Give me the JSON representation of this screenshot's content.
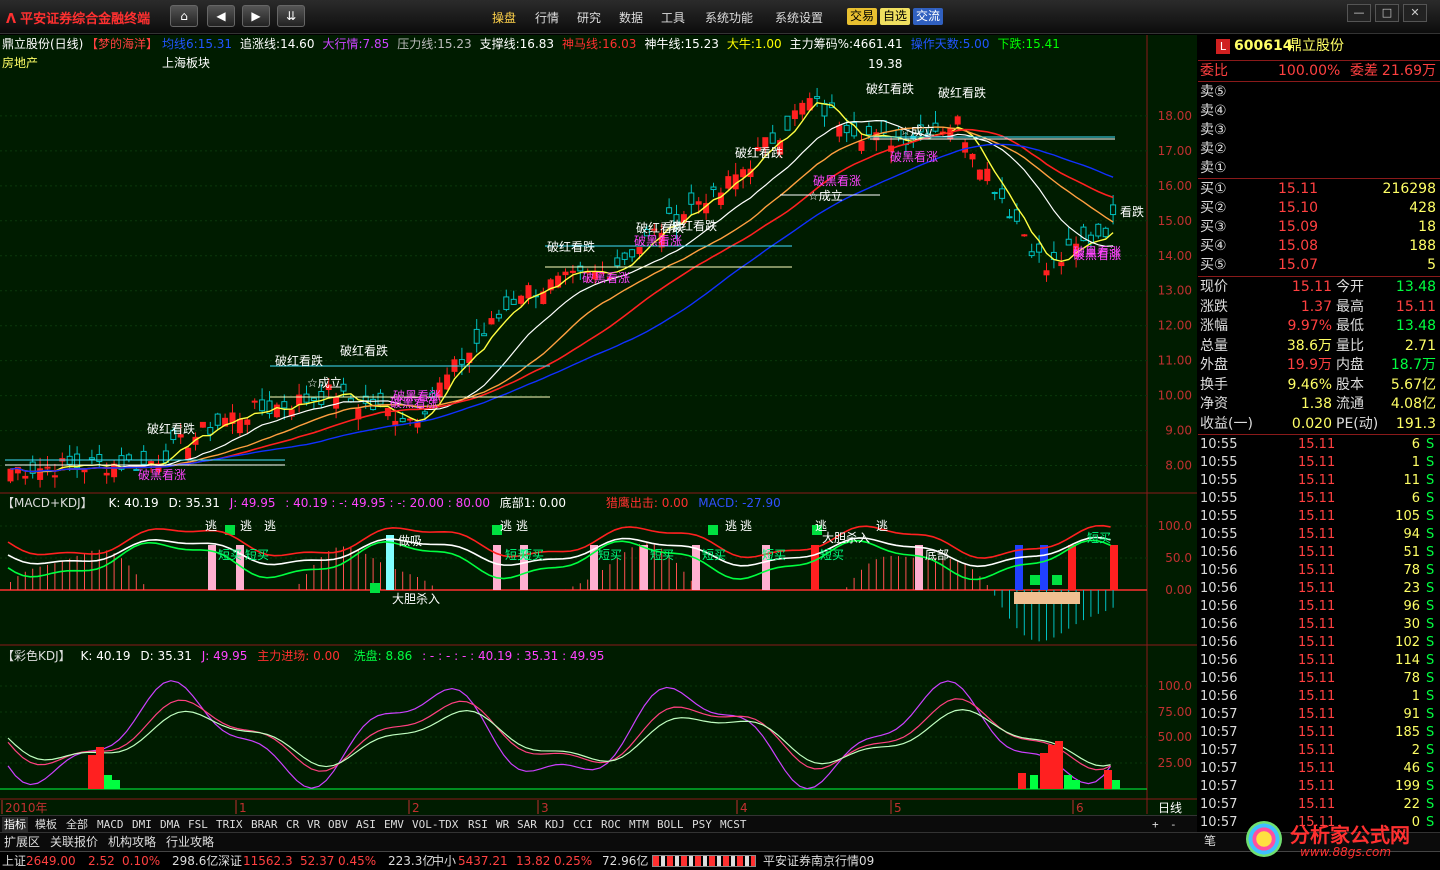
{
  "topbar": {
    "brand": "平安证券综合金融终端",
    "menu": [
      "操盘",
      "行情",
      "研究",
      "数据",
      "工具",
      "系统功能",
      "系统设置"
    ],
    "pills": [
      "交易",
      "自选",
      "交流"
    ]
  },
  "indicators": {
    "title": "鼎立股份(日线)",
    "formula": "【梦的海洋】",
    "sector": "房地产",
    "board": "上海板块",
    "items": [
      {
        "t": "均线6:",
        "v": "15.31",
        "c": "#2255ff"
      },
      {
        "t": "追涨线:",
        "v": "14.60",
        "c": "#ffffff"
      },
      {
        "t": "大行情:",
        "v": "7.85",
        "c": "#cc44ff"
      },
      {
        "t": "压力线:",
        "v": "15.23",
        "c": "#bbbbbb"
      },
      {
        "t": "支撑线:",
        "v": "16.83",
        "c": "#ffffff"
      },
      {
        "t": "神马线:",
        "v": "16.03",
        "c": "#ff3030"
      },
      {
        "t": "神牛线:",
        "v": "15.23",
        "c": "#ffffff"
      },
      {
        "t": "大牛:",
        "v": "1.00",
        "c": "#ffff00"
      },
      {
        "t": "主力筹码%:",
        "v": "4661.41",
        "c": "#ffffff"
      },
      {
        "t": "操作天数:",
        "v": "5.00",
        "c": "#2255ff"
      },
      {
        "t": "下跌:",
        "v": "15.41",
        "c": "#00ff00"
      }
    ]
  },
  "price_axis": [
    "18.00",
    "17.00",
    "16.00",
    "15.00",
    "14.00",
    "13.00",
    "12.00",
    "11.00",
    "10.00",
    "9.00",
    "8.00"
  ],
  "annotations": [
    {
      "t": "19.38",
      "c": "#ffffff"
    },
    {
      "t": "破红看跌",
      "c": "#ffffff"
    },
    {
      "t": "破红看跌",
      "c": "#ffffff"
    },
    {
      "t": "☆成立",
      "c": "#ffffff"
    },
    {
      "t": "破黑看涨",
      "c": "#ff44ff"
    },
    {
      "t": "破黑看涨",
      "c": "#ff44ff"
    },
    {
      "t": "☆成立",
      "c": "#ffffff"
    },
    {
      "t": "破黑看涨",
      "c": "#ff44ff"
    },
    {
      "t": "破红看跌",
      "c": "#ffffff"
    },
    {
      "t": "破黑看涨",
      "c": "#ff44ff"
    },
    {
      "t": "破红看跌",
      "c": "#ffffff"
    },
    {
      "t": "破黑看涨",
      "c": "#ff44ff"
    },
    {
      "t": "破红看跌",
      "c": "#ffffff"
    },
    {
      "t": "☆成立",
      "c": "#ffffff"
    },
    {
      "t": "破黑看涨",
      "c": "#ff44ff"
    },
    {
      "t": "破红看跌",
      "c": "#ffffff"
    },
    {
      "t": "破红看跌",
      "c": "#ffffff"
    },
    {
      "t": "破黑看涨",
      "c": "#ff44ff"
    },
    {
      "t": "破黑看涨",
      "c": "#ff44ff"
    },
    {
      "t": "看跌",
      "c": "#ffffff"
    },
    {
      "t": "破黑看涨",
      "c": "#ff44ff"
    },
    {
      "t": "破红看跌",
      "c": "#ffffff"
    },
    {
      "t": "破红看跌",
      "c": "#ffffff"
    }
  ],
  "macd": {
    "title": "【MACD+KDJ】",
    "k": "K: 40.19",
    "d": "D: 35.31",
    "j": "J: 49.95",
    "vals": ": 40.19 : -: 49.95 : -: 20.00 : 80.00",
    "bottom": "底部1: 0.00",
    "hawk": "猎鹰出击: 0.00",
    "macdv": "MACD: -27.90",
    "axis": [
      "100.0",
      "50.0",
      "0.00"
    ],
    "labels": [
      "逃",
      "逃",
      "逃",
      "逃",
      "逃",
      "逃",
      "逃",
      "逃",
      "逃",
      "短买",
      "短买",
      "短买",
      "短买",
      "短买",
      "短买",
      "短买",
      "短买",
      "底部",
      "做吸",
      "大胆杀入",
      "大胆杀入",
      "短买",
      "短买"
    ]
  },
  "kdj": {
    "title": "【彩色KDJ】",
    "k": "K: 40.19",
    "d": "D: 35.31",
    "j": "J: 49.95",
    "main": "主力进场: 0.00",
    "wash": "洗盘: 8.86",
    "vals": ": - : - : - : 40.19 : 35.31 : 49.95",
    "axis": [
      "100.0",
      "75.00",
      "50.00",
      "25.00"
    ]
  },
  "dates": [
    "2010年",
    "1",
    "2",
    "3",
    "4",
    "5",
    "6"
  ],
  "period": "日线",
  "tabs": [
    "指标",
    "模板",
    "全部",
    "MACD",
    "DMI",
    "DMA",
    "FSL",
    "TRIX",
    "BRAR",
    "CR",
    "VR",
    "OBV",
    "ASI",
    "EMV",
    "VOL-TDX",
    "RSI",
    "WR",
    "SAR",
    "KDJ",
    "CCI",
    "ROC",
    "MTM",
    "BOLL",
    "PSY",
    "MCST"
  ],
  "tabs2": [
    "扩展区",
    "关联报价",
    "机构攻略",
    "行业攻略"
  ],
  "side": {
    "code": "600614",
    "name": "鼎立股份",
    "ratio_label": "委比",
    "ratio": "100.00%",
    "diff_label": "委差",
    "diff": "21.69万",
    "sells": [
      "卖⑤",
      "卖④",
      "卖③",
      "卖②",
      "卖①"
    ],
    "buys": [
      {
        "l": "买①",
        "p": "15.11",
        "v": "216298"
      },
      {
        "l": "买②",
        "p": "15.10",
        "v": "428"
      },
      {
        "l": "买③",
        "p": "15.09",
        "v": "18"
      },
      {
        "l": "买④",
        "p": "15.08",
        "v": "188"
      },
      {
        "l": "买⑤",
        "p": "15.07",
        "v": "5"
      }
    ],
    "stats": [
      {
        "a": "现价",
        "b": "15.11",
        "bc": "#ff4040",
        "c": "今开",
        "d": "13.48",
        "dc": "#00ff40"
      },
      {
        "a": "涨跌",
        "b": "1.37",
        "bc": "#ff4040",
        "c": "最高",
        "d": "15.11",
        "dc": "#ff4040"
      },
      {
        "a": "涨幅",
        "b": "9.97%",
        "bc": "#ff4040",
        "c": "最低",
        "d": "13.48",
        "dc": "#00ff40"
      },
      {
        "a": "总量",
        "b": "38.6万",
        "bc": "#ffff66",
        "c": "量比",
        "d": "2.71",
        "dc": "#ffff66"
      },
      {
        "a": "外盘",
        "b": "19.9万",
        "bc": "#ff4040",
        "c": "内盘",
        "d": "18.7万",
        "dc": "#00ff40"
      },
      {
        "a": "换手",
        "b": "9.46%",
        "bc": "#ffff66",
        "c": "股本",
        "d": "5.67亿",
        "dc": "#ffff66"
      },
      {
        "a": "净资",
        "b": "1.38",
        "bc": "#ffff66",
        "c": "流通",
        "d": "4.08亿",
        "dc": "#ffff66"
      },
      {
        "a": "收益(一)",
        "b": "0.020",
        "bc": "#ffff66",
        "c": "PE(动)",
        "d": "191.3",
        "dc": "#ffff66"
      }
    ],
    "ticks": [
      {
        "t": "10:55",
        "p": "15.11",
        "v": "6"
      },
      {
        "t": "10:55",
        "p": "15.11",
        "v": "1"
      },
      {
        "t": "10:55",
        "p": "15.11",
        "v": "11"
      },
      {
        "t": "10:55",
        "p": "15.11",
        "v": "6"
      },
      {
        "t": "10:55",
        "p": "15.11",
        "v": "105"
      },
      {
        "t": "10:55",
        "p": "15.11",
        "v": "94"
      },
      {
        "t": "10:56",
        "p": "15.11",
        "v": "51"
      },
      {
        "t": "10:56",
        "p": "15.11",
        "v": "78"
      },
      {
        "t": "10:56",
        "p": "15.11",
        "v": "23"
      },
      {
        "t": "10:56",
        "p": "15.11",
        "v": "96"
      },
      {
        "t": "10:56",
        "p": "15.11",
        "v": "30"
      },
      {
        "t": "10:56",
        "p": "15.11",
        "v": "102"
      },
      {
        "t": "10:56",
        "p": "15.11",
        "v": "114"
      },
      {
        "t": "10:56",
        "p": "15.11",
        "v": "78"
      },
      {
        "t": "10:56",
        "p": "15.11",
        "v": "1"
      },
      {
        "t": "10:57",
        "p": "15.11",
        "v": "91"
      },
      {
        "t": "10:57",
        "p": "15.11",
        "v": "185"
      },
      {
        "t": "10:57",
        "p": "15.11",
        "v": "2"
      },
      {
        "t": "10:57",
        "p": "15.11",
        "v": "46"
      },
      {
        "t": "10:57",
        "p": "15.11",
        "v": "199"
      },
      {
        "t": "10:57",
        "p": "15.11",
        "v": "22"
      },
      {
        "t": "10:57",
        "p": "15.11",
        "v": "0"
      }
    ],
    "tick_side": "S",
    "pen": "笔",
    "watermark": "分析家公式网",
    "watermark_url": "www.88gs.com"
  },
  "status": {
    "sh_label": "上证",
    "sh": "2649.00",
    "sh_chg": "2.52",
    "sh_pct": "0.10%",
    "sh_amt": "298.6亿",
    "sz_label": "深证",
    "sz": "11562.3",
    "sz_chg": "52.37",
    "sz_pct": "0.45%",
    "sz_amt": "223.3亿",
    "zx_label": "中小",
    "zx": "5437.21",
    "zx_chg": "13.82",
    "zx_pct": "0.25%",
    "zx_amt": "72.96亿",
    "server": "平安证券南京行情09"
  }
}
